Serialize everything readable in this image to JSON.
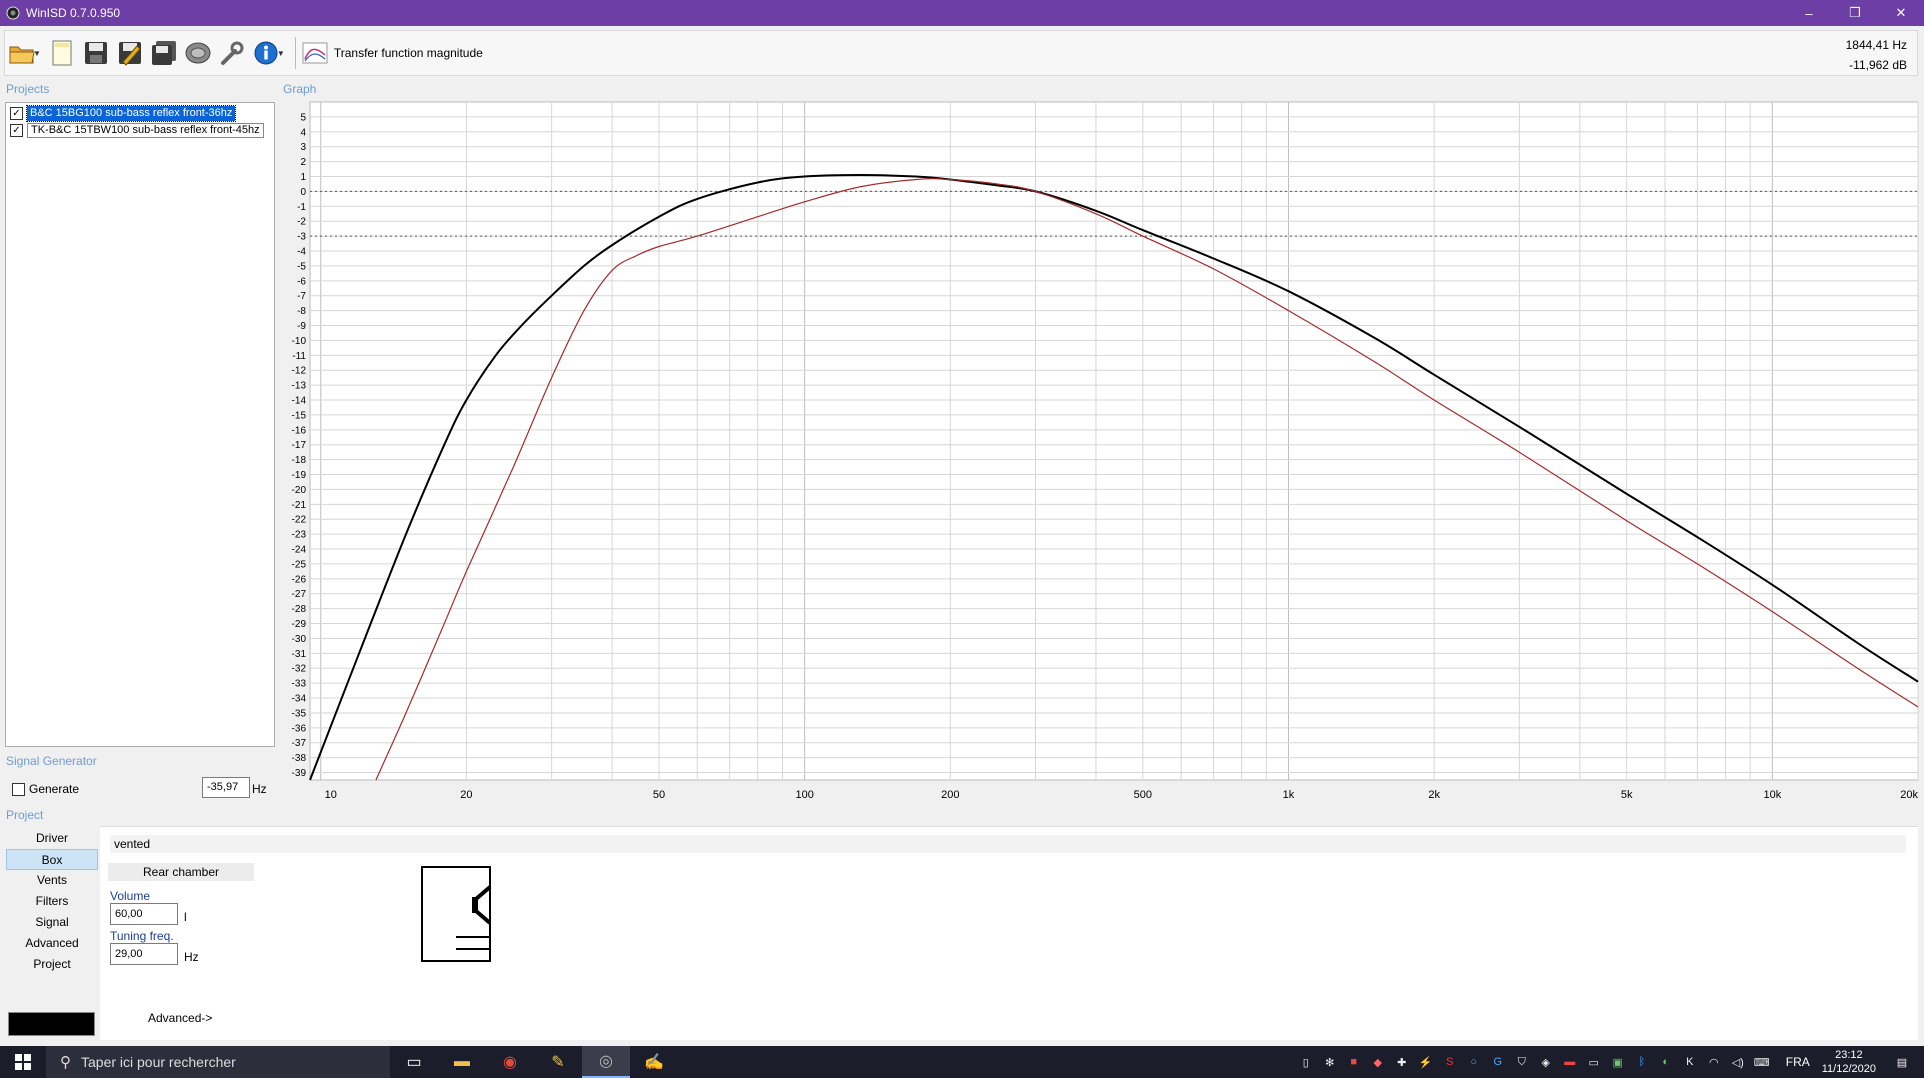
{
  "window": {
    "title": "WinISD 0.7.0.950",
    "controls": [
      "–",
      "❐",
      "✕"
    ]
  },
  "toolbar": {
    "graph_selector_label": "Transfer function magnitude",
    "readout_freq": "1844,41 Hz",
    "readout_db": "-11,962 dB"
  },
  "sections": {
    "projects": "Projects",
    "graph": "Graph",
    "signal_generator": "Signal Generator",
    "project": "Project"
  },
  "projects": [
    {
      "name": "B&C 15BG100 sub-bass reflex front-36hz",
      "checked": true,
      "selected": true,
      "color": "#000000"
    },
    {
      "name": "TK-B&C 15TBW100 sub-bass reflex front-45hz",
      "checked": true,
      "selected": false,
      "color": "#a52a2a"
    }
  ],
  "signal_generator": {
    "generate_label": "Generate",
    "generate_checked": false,
    "value": "-35,97",
    "unit": "Hz"
  },
  "nav_items": [
    "Driver",
    "Box",
    "Vents",
    "Filters",
    "Signal",
    "Advanced",
    "Project"
  ],
  "nav_active": "Box",
  "box": {
    "type": "vented",
    "tab": "Rear chamber",
    "volume_label": "Volume",
    "volume_value": "60,00",
    "volume_unit": "l",
    "tuning_label": "Tuning freq.",
    "tuning_value": "29,00",
    "tuning_unit": "Hz",
    "advanced_link": "Advanced->"
  },
  "chart_data": {
    "type": "line",
    "x_scale": "log",
    "xlim": [
      9.5,
      20000
    ],
    "ylim": [
      -39.5,
      6
    ],
    "x_ticks": [
      10,
      20,
      50,
      100,
      200,
      500,
      1000,
      2000,
      5000,
      10000,
      20000
    ],
    "x_tick_labels": [
      "10",
      "20",
      "50",
      "100",
      "200",
      "500",
      "1k",
      "2k",
      "5k",
      "10k",
      "20k"
    ],
    "y_ticks": [
      5,
      4,
      3,
      2,
      1,
      0,
      -1,
      -2,
      -3,
      -4,
      -5,
      -6,
      -7,
      -8,
      -9,
      -10,
      -11,
      -12,
      -13,
      -14,
      -15,
      -16,
      -17,
      -18,
      -19,
      -20,
      -21,
      -22,
      -23,
      -24,
      -25,
      -26,
      -27,
      -28,
      -29,
      -30,
      -31,
      -32,
      -33,
      -34,
      -35,
      -36,
      -37,
      -38,
      -39
    ],
    "reference_lines": [
      0,
      -3
    ],
    "grid": true,
    "series": [
      {
        "name": "B&C 15BG100 sub-bass reflex front-36hz",
        "color": "#000000",
        "x": [
          9.5,
          12,
          15,
          18,
          20,
          23,
          26,
          30,
          35,
          40,
          50,
          60,
          80,
          100,
          130,
          170,
          200,
          250,
          300,
          400,
          500,
          700,
          1000,
          1500,
          2000,
          3000,
          5000,
          7000,
          10000,
          15000,
          20000
        ],
        "y": [
          -39.5,
          -31,
          -23,
          -17,
          -14,
          -11,
          -9,
          -7,
          -5,
          -3.6,
          -1.7,
          -0.5,
          0.6,
          1.0,
          1.1,
          1.0,
          0.8,
          0.4,
          0,
          -1.3,
          -2.6,
          -4.5,
          -6.7,
          -9.8,
          -12.3,
          -15.8,
          -20.3,
          -23.2,
          -26.4,
          -30.3,
          -32.9
        ]
      },
      {
        "name": "TK-B&C 15TBW100 sub-bass reflex front-45hz",
        "color": "#a52a2a",
        "x": [
          13,
          15,
          18,
          20,
          25,
          30,
          35,
          40,
          45,
          50,
          60,
          80,
          100,
          130,
          170,
          200,
          250,
          300,
          400,
          500,
          700,
          1000,
          1500,
          2000,
          3000,
          5000,
          7000,
          10000,
          15000,
          20000
        ],
        "y": [
          -39.5,
          -35,
          -29,
          -25.5,
          -18.5,
          -12.5,
          -8,
          -5.3,
          -4.3,
          -3.7,
          -3.0,
          -1.7,
          -0.7,
          0.3,
          0.8,
          0.8,
          0.5,
          0,
          -1.5,
          -3.0,
          -5.2,
          -8.0,
          -11.4,
          -14.0,
          -17.5,
          -22.1,
          -25.0,
          -28.2,
          -32.0,
          -34.6
        ]
      }
    ]
  },
  "taskbar": {
    "search_placeholder": "Taper ici pour rechercher",
    "language": "FRA",
    "time": "23:12",
    "date": "11/12/2020"
  }
}
